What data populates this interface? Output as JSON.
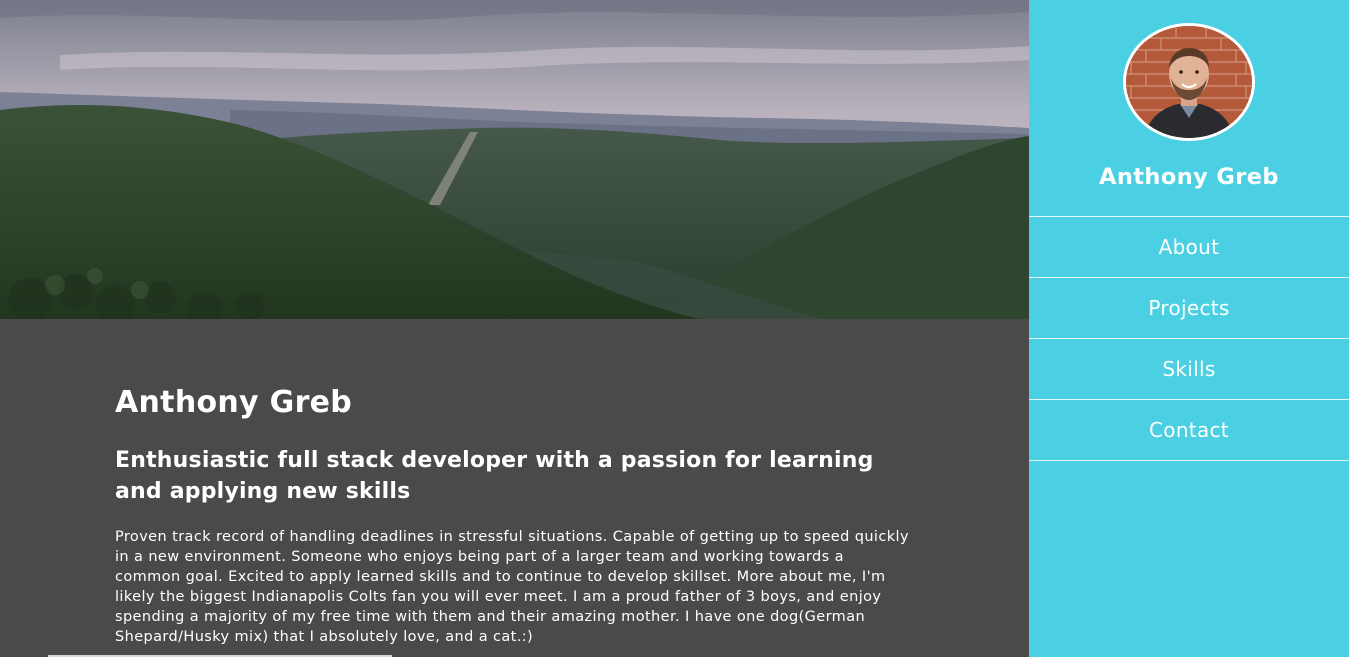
{
  "hero": {
    "image": "forested-mountain-valley-landscape"
  },
  "main": {
    "name": "Anthony Greb",
    "tagline": "Enthusiastic full stack developer with a passion for learning and applying new skills",
    "bio": "Proven track record of handling deadlines in stressful situations. Capable of getting up to speed quickly in a new environment. Someone who enjoys being part of a larger team and working towards a common goal. Excited to apply learned skills and to continue to develop skillset. More about me, I'm likely the biggest Indianapolis Colts fan you will ever meet. I am a proud father of 3 boys, and enjoy spending a majority of my free time with them and their amazing mother. I have one dog(German Shepard/Husky mix) that I absolutely love, and a cat.:)"
  },
  "sidebar": {
    "avatar": "profile-photo",
    "name": "Anthony Greb",
    "nav": [
      {
        "label": "About"
      },
      {
        "label": "Projects"
      },
      {
        "label": "Skills"
      },
      {
        "label": "Contact"
      }
    ]
  },
  "colors": {
    "sidebar_bg": "#4ad0e2",
    "content_bg": "#4a4a4a",
    "text": "#ffffff"
  }
}
